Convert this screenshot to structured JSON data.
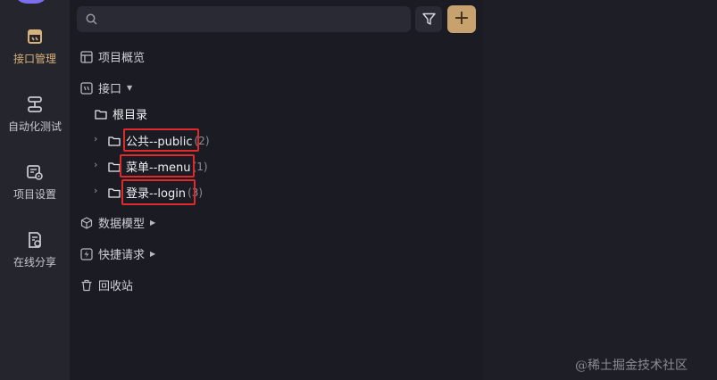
{
  "rail": {
    "items": [
      {
        "label": "接口管理",
        "icon": "api-icon",
        "active": true
      },
      {
        "label": "自动化测试",
        "icon": "automation-icon",
        "active": false
      },
      {
        "label": "项目设置",
        "icon": "settings-icon",
        "active": false
      },
      {
        "label": "在线分享",
        "icon": "share-icon",
        "active": false
      }
    ]
  },
  "toolbar": {
    "search_placeholder": "",
    "filter_icon": "filter-icon",
    "add_label": "+"
  },
  "tree": {
    "overview_label": "项目概览",
    "api_label": "接口",
    "root_label": "根目录",
    "folders": [
      {
        "label": "公共--public",
        "count": "(2)"
      },
      {
        "label": "菜单--menu",
        "count": "(1)"
      },
      {
        "label": "登录--login",
        "count": "(3)"
      }
    ],
    "models_label": "数据模型",
    "quick_label": "快捷请求",
    "trash_label": "回收站"
  },
  "watermark": "@稀土掘金技术社区",
  "colors": {
    "accent": "#c7a26f",
    "active_text": "#d7b27a",
    "highlight": "#e02a2a",
    "logo": "#7b6ff0"
  }
}
